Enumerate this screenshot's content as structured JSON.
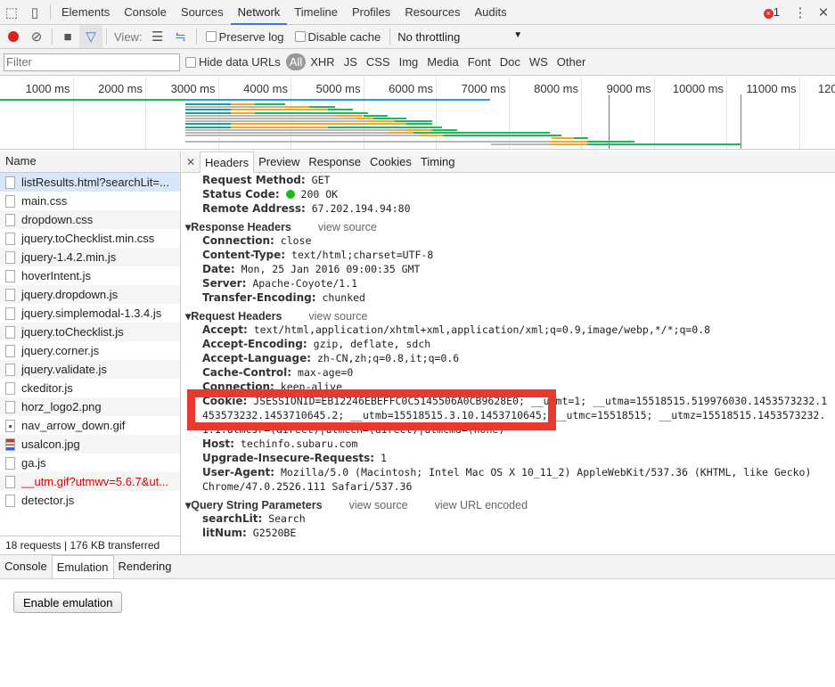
{
  "tabs": [
    "Elements",
    "Console",
    "Sources",
    "Network",
    "Timeline",
    "Profiles",
    "Resources",
    "Audits"
  ],
  "active_tab": "Network",
  "error_count": "1",
  "toolbar": {
    "view_label": "View:",
    "preserve_log": "Preserve log",
    "disable_cache": "Disable cache",
    "throttling": "No throttling"
  },
  "filterbar": {
    "placeholder": "Filter",
    "hide_data_urls": "Hide data URLs",
    "types": [
      "All",
      "XHR",
      "JS",
      "CSS",
      "Img",
      "Media",
      "Font",
      "Doc",
      "WS",
      "Other"
    ]
  },
  "timeline": {
    "ticks": [
      "1000 ms",
      "2000 ms",
      "3000 ms",
      "4000 ms",
      "5000 ms",
      "6000 ms",
      "7000 ms",
      "8000 ms",
      "9000 ms",
      "10000 ms",
      "11000 ms",
      "12000 ms"
    ],
    "colors": {
      "waiting": "#1a9e9e",
      "queued": "#b8b8b8",
      "ttfb": "#f5a623",
      "download": "#1dba5a",
      "domcontentloaded": "#6b6bf0",
      "load": "#e05050",
      "main": "#2b9be0"
    },
    "domcontentloaded_ms": 8380,
    "load_ms": 10200,
    "waterfall": [
      [
        2550,
        3180,
        3510,
        3930,
        "teal"
      ],
      [
        2550,
        3930,
        4260,
        4610,
        "gray"
      ],
      [
        2550,
        3180,
        4520,
        4860,
        "teal"
      ],
      [
        2550,
        3180,
        3510,
        5070,
        "teal"
      ],
      [
        2550,
        4630,
        5000,
        5340,
        "gray"
      ],
      [
        2550,
        4890,
        5140,
        5600,
        "gray"
      ],
      [
        2550,
        5070,
        5440,
        5950,
        "gray"
      ],
      [
        2550,
        3180,
        5600,
        5950,
        "teal"
      ],
      [
        2550,
        3180,
        4520,
        6080,
        "teal"
      ],
      [
        2550,
        5620,
        5950,
        6300,
        "gray"
      ],
      [
        2550,
        5340,
        5690,
        7570,
        "gray"
      ],
      [
        2550,
        5780,
        6100,
        7730,
        "gray"
      ],
      [
        7600,
        7600,
        7900,
        8100,
        "gray"
      ],
      [
        2550,
        7570,
        8080,
        8740,
        "gray"
      ],
      [
        6760,
        7570,
        8080,
        10210,
        "gray"
      ]
    ]
  },
  "name_header": "Name",
  "requests": [
    {
      "name": "listResults.html?searchLit=...",
      "icon": "file"
    },
    {
      "name": "main.css",
      "icon": "file"
    },
    {
      "name": "dropdown.css",
      "icon": "file"
    },
    {
      "name": "jquery.toChecklist.min.css",
      "icon": "file"
    },
    {
      "name": "jquery-1.4.2.min.js",
      "icon": "file"
    },
    {
      "name": "hoverIntent.js",
      "icon": "file"
    },
    {
      "name": "jquery.dropdown.js",
      "icon": "file"
    },
    {
      "name": "jquery.simplemodal-1.3.4.js",
      "icon": "file"
    },
    {
      "name": "jquery.toChecklist.js",
      "icon": "file"
    },
    {
      "name": "jquery.corner.js",
      "icon": "file"
    },
    {
      "name": "jquery.validate.js",
      "icon": "file"
    },
    {
      "name": "ckeditor.js",
      "icon": "file"
    },
    {
      "name": "horz_logo2.png",
      "icon": "file"
    },
    {
      "name": "nav_arrow_down.gif",
      "icon": "img"
    },
    {
      "name": "usalcon.jpg",
      "icon": "flag"
    },
    {
      "name": "ga.js",
      "icon": "file"
    },
    {
      "name": "__utm.gif?utmwv=5.6.7&ut...",
      "icon": "file",
      "error": true
    },
    {
      "name": "detector.js",
      "icon": "file"
    }
  ],
  "summary": "18 requests | 176 KB transferred",
  "detail_tabs": [
    "Headers",
    "Preview",
    "Response",
    "Cookies",
    "Timing"
  ],
  "general": [
    [
      "Request Method:",
      "GET"
    ],
    [
      "Status Code:",
      "200 OK"
    ],
    [
      "Remote Address:",
      "67.202.194.94:80"
    ]
  ],
  "response_headers": {
    "title": "Response Headers",
    "view_source": "view source",
    "rows": [
      [
        "Connection:",
        "close"
      ],
      [
        "Content-Type:",
        "text/html;charset=UTF-8"
      ],
      [
        "Date:",
        "Mon, 25 Jan 2016 09:00:35 GMT"
      ],
      [
        "Server:",
        "Apache-Coyote/1.1"
      ],
      [
        "Transfer-Encoding:",
        "chunked"
      ]
    ]
  },
  "request_headers": {
    "title": "Request Headers",
    "view_source": "view source",
    "rows": [
      [
        "Accept:",
        "text/html,application/xhtml+xml,application/xml;q=0.9,image/webp,*/*;q=0.8"
      ],
      [
        "Accept-Encoding:",
        "gzip, deflate, sdch"
      ],
      [
        "Accept-Language:",
        "zh-CN,zh;q=0.8,it;q=0.6"
      ],
      [
        "Cache-Control:",
        "max-age=0"
      ],
      [
        "Connection:",
        "keep-alive"
      ],
      [
        "Cookie:",
        "JSESSIONID=EB12246EBEFFC0C5145506A0CB9628E0; __utmt=1; __utma=15518515.519976030.1453573232.1453573232.1453710645.2; __utmb=15518515.3.10.1453710645; __utmc=15518515; __utmz=15518515.1453573232.1.1.utmcsr=(direct)|utmccn=(direct)|utmcmd=(none)"
      ],
      [
        "Host:",
        "techinfo.subaru.com"
      ],
      [
        "Upgrade-Insecure-Requests:",
        "1"
      ],
      [
        "User-Agent:",
        "Mozilla/5.0 (Macintosh; Intel Mac OS X 10_11_2) AppleWebKit/537.36 (KHTML, like Gecko) Chrome/47.0.2526.111 Safari/537.36"
      ]
    ]
  },
  "query_params": {
    "title": "Query String Parameters",
    "view_source": "view source",
    "view_encoded": "view URL encoded",
    "rows": [
      [
        "searchLit:",
        "Search"
      ],
      [
        "litNum:",
        "G2520BE"
      ]
    ]
  },
  "drawer": {
    "tabs": [
      "Console",
      "Emulation",
      "Rendering"
    ],
    "active": "Emulation",
    "enable_button": "Enable emulation"
  },
  "highlight_color": "#e8382f"
}
